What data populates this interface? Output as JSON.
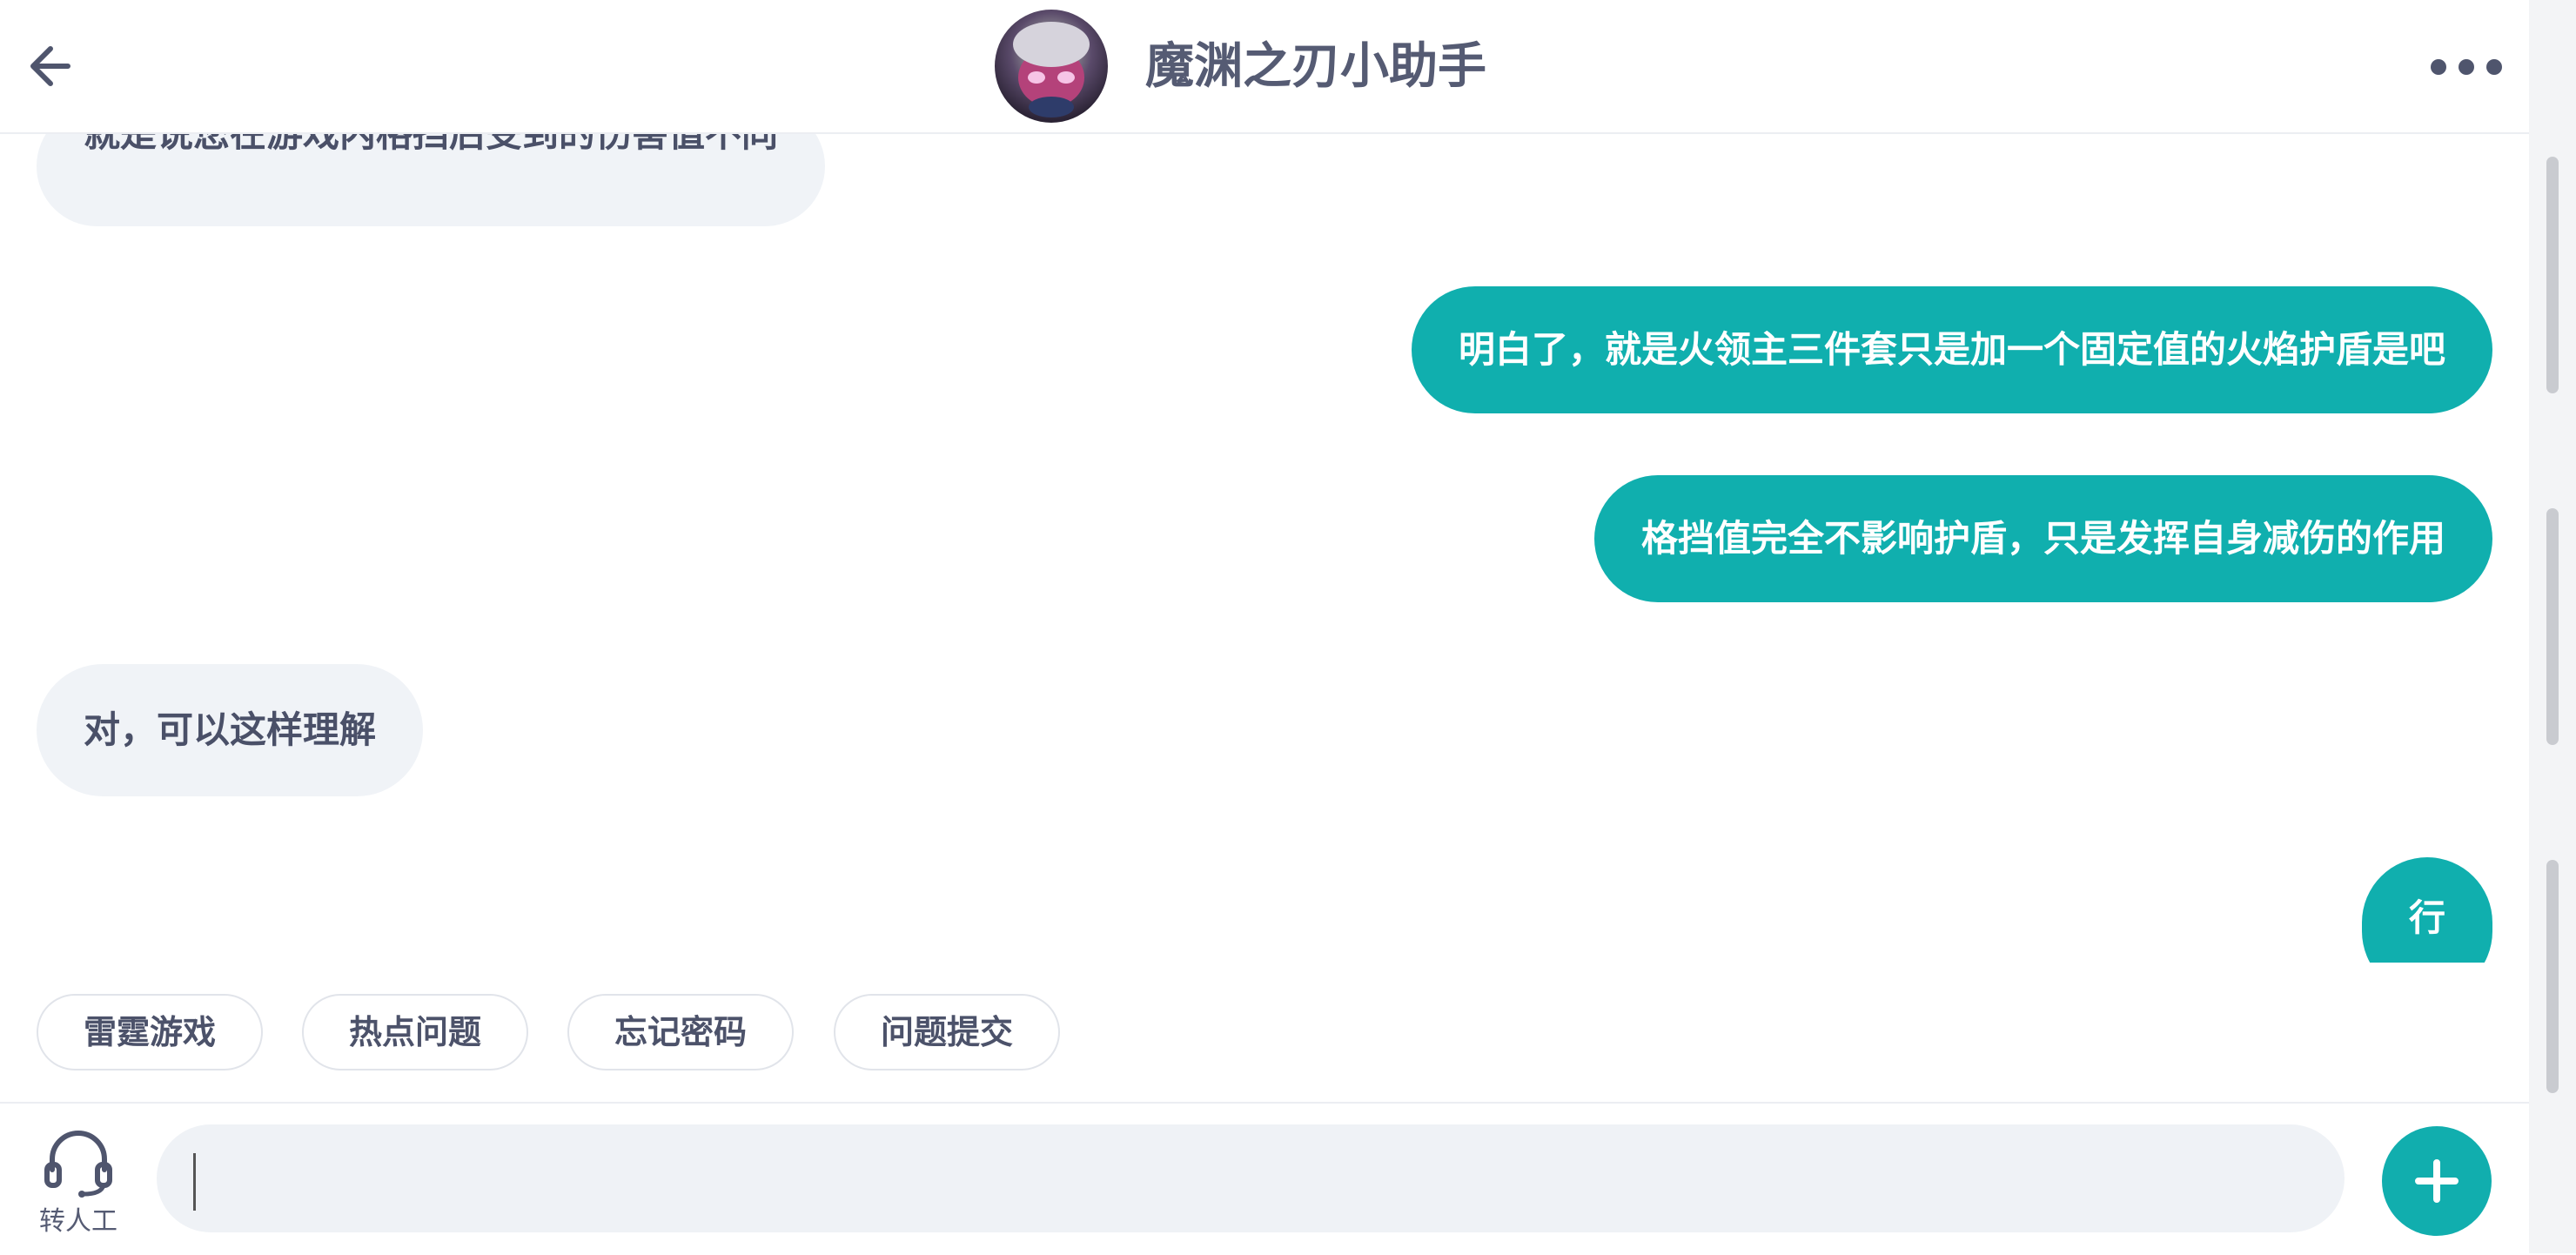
{
  "header": {
    "title": "魔渊之刃小助手",
    "back_icon": "arrow-left-icon",
    "more_icon": "more-horizontal-icon"
  },
  "messages": [
    {
      "from": "bot",
      "text": "就是说您在游戏内格挡后受到的伤害值不同"
    },
    {
      "from": "user",
      "text": "明白了，就是火领主三件套只是加一个固定值的火焰护盾是吧"
    },
    {
      "from": "user",
      "text": "格挡值完全不影响护盾，只是发挥自身减伤的作用"
    },
    {
      "from": "bot",
      "text": "对，可以这样理解"
    },
    {
      "from": "user",
      "text": "行"
    }
  ],
  "quick_replies": [
    "雷霆游戏",
    "热点问题",
    "忘记密码",
    "问题提交"
  ],
  "footer": {
    "agent_label": "转人工",
    "agent_icon": "headset-icon",
    "input_value": "",
    "plus_icon": "plus-icon"
  },
  "colors": {
    "accent": "#10afae",
    "bot_bubble": "#f0f3f7",
    "text_dark": "#4a5068"
  }
}
